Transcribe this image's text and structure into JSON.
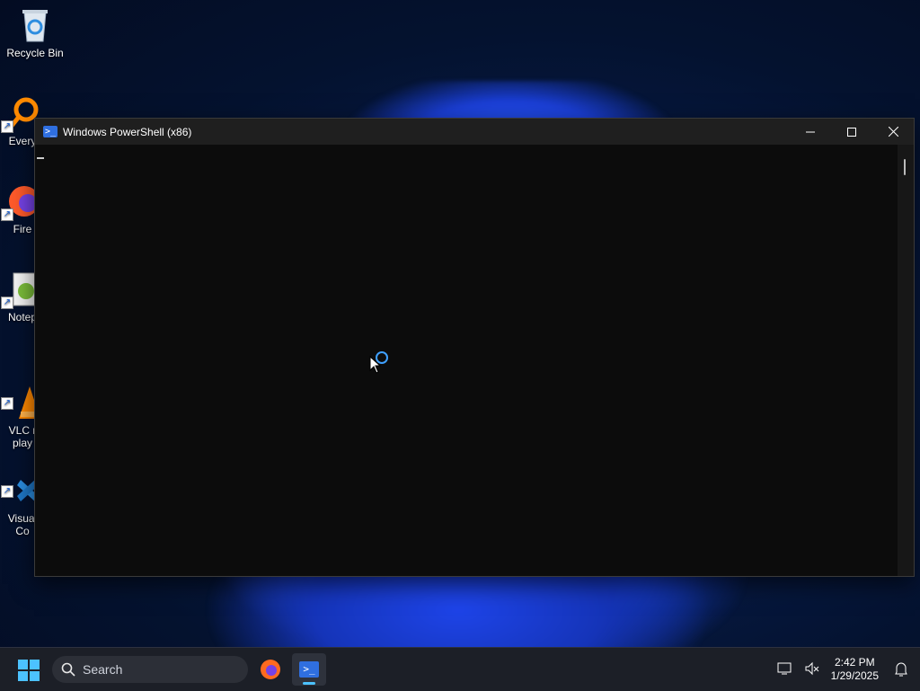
{
  "desktop": {
    "icons": [
      {
        "label": "Recycle Bin"
      },
      {
        "label": "Every"
      },
      {
        "label": "Fire"
      },
      {
        "label": "Notep"
      },
      {
        "label": "VLC r\nplay"
      },
      {
        "label": "Visual\nCo"
      }
    ]
  },
  "window": {
    "title": "Windows PowerShell (x86)",
    "icon": "powershell-icon",
    "controls": [
      "minimize",
      "maximize",
      "close"
    ]
  },
  "taskbar": {
    "search_placeholder": "Search",
    "apps": [
      "firefox-icon",
      "powershell-icon"
    ],
    "active_app": "powershell-icon",
    "time": "2:42 PM",
    "date": "1/29/2025"
  },
  "colors": {
    "accent": "#4cc2ff",
    "console_bg": "#0c0c0c",
    "titlebar_bg": "#1f1f1f",
    "taskbar_bg": "#1c1f27"
  }
}
